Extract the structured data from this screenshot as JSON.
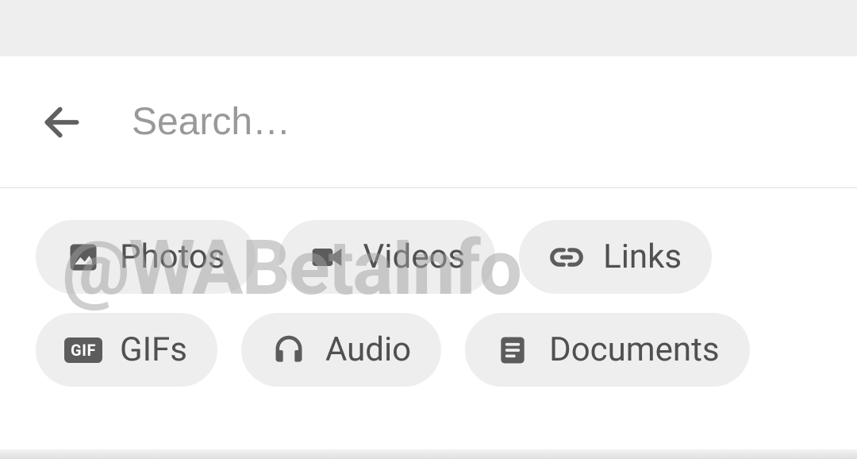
{
  "search": {
    "placeholder": "Search…",
    "value": ""
  },
  "chips": [
    {
      "icon": "photo",
      "label": "Photos"
    },
    {
      "icon": "video",
      "label": "Videos"
    },
    {
      "icon": "link",
      "label": "Links"
    },
    {
      "icon": "gif",
      "label": "GIFs"
    },
    {
      "icon": "audio",
      "label": "Audio"
    },
    {
      "icon": "document",
      "label": "Documents"
    }
  ],
  "watermark": "@WABetaInfo"
}
